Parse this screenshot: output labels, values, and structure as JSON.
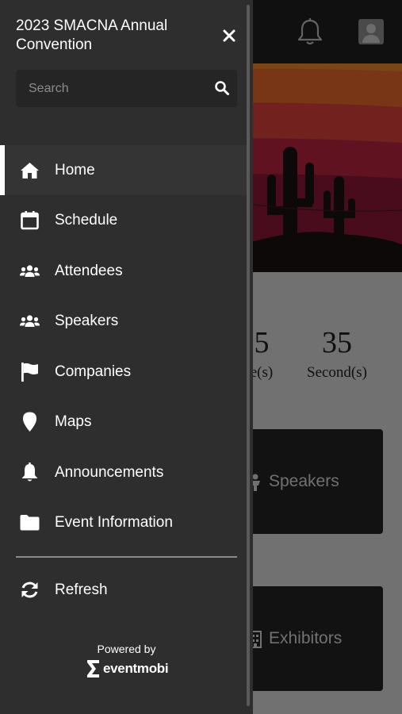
{
  "drawer": {
    "title": "2023 SMACNA Annual Convention",
    "search": {
      "placeholder": "Search",
      "value": ""
    },
    "nav_items": [
      {
        "label": "Home",
        "icon": "home-icon",
        "active": true
      },
      {
        "label": "Schedule",
        "icon": "calendar-icon",
        "active": false
      },
      {
        "label": "Attendees",
        "icon": "people-group-icon",
        "active": false
      },
      {
        "label": "Speakers",
        "icon": "people-group-icon",
        "active": false
      },
      {
        "label": "Companies",
        "icon": "flag-icon",
        "active": false
      },
      {
        "label": "Maps",
        "icon": "map-pin-icon",
        "active": false
      },
      {
        "label": "Announcements",
        "icon": "bell-icon",
        "active": false
      },
      {
        "label": "Event Information",
        "icon": "folder-icon",
        "active": false
      }
    ],
    "refresh_label": "Refresh",
    "powered_by": "Powered by",
    "logo_text": "eventmobi"
  },
  "background": {
    "countdown": [
      {
        "value": "5",
        "label": "e(s)"
      },
      {
        "value": "35",
        "label": "Second(s)"
      }
    ],
    "tiles": [
      {
        "label": "Speakers",
        "icon": "speaker-icon"
      },
      {
        "label": "Exhibitors",
        "icon": "building-icon"
      }
    ]
  },
  "colors": {
    "drawer_bg": "#2e2e2e",
    "search_bg": "#252525",
    "active_item_bg": "#343434",
    "active_indicator": "#ffffff",
    "topbar_bg": "#1f1f1f",
    "overlay": "rgba(0,0,0,0.48)"
  }
}
